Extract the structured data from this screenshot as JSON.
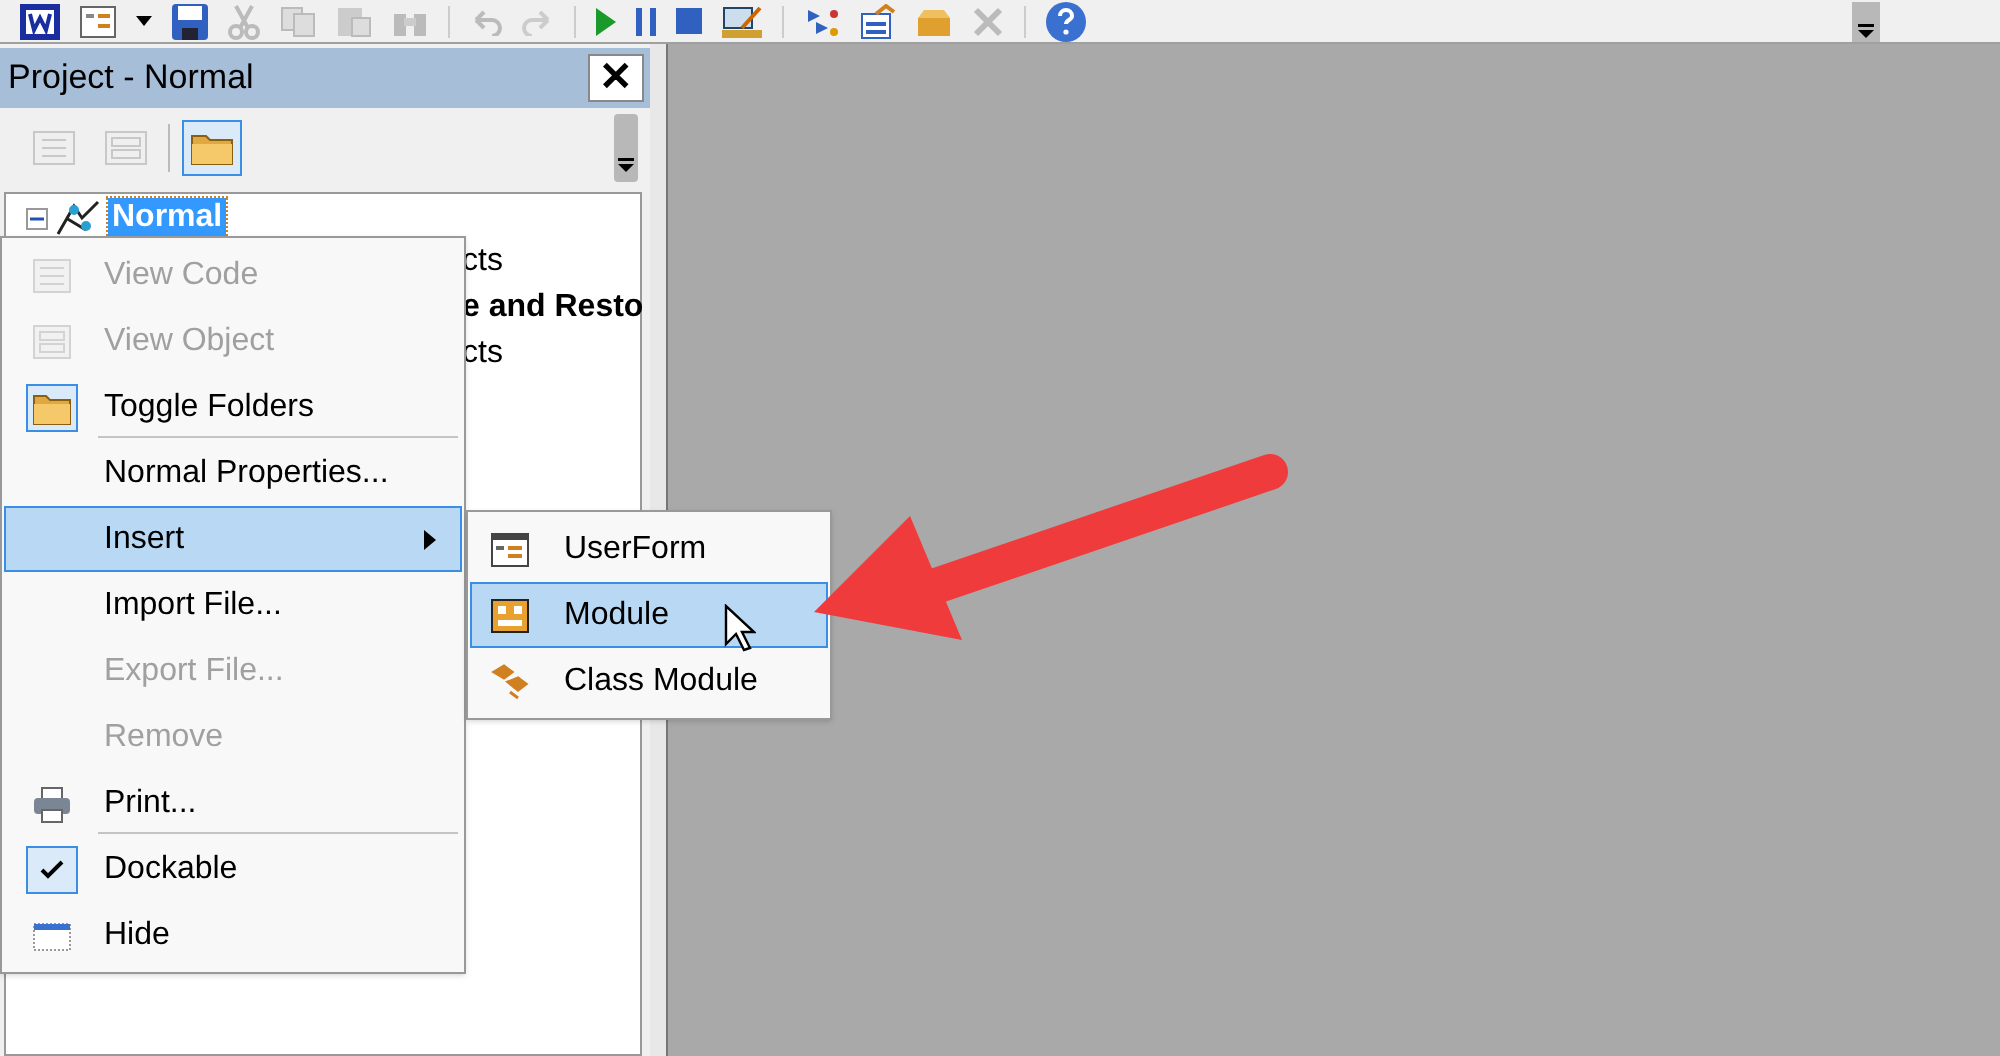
{
  "project_panel": {
    "title": "Project - Normal",
    "close_glyph": "✕",
    "toolbar": [
      {
        "disabled": true,
        "selected": false
      },
      {
        "disabled": true,
        "selected": false
      },
      {
        "disabled": false,
        "selected": true
      }
    ],
    "tree": [
      {
        "label": "Normal",
        "selected": true,
        "expanded": true,
        "children": [
          {
            "label": "cts",
            "selected": false
          },
          {
            "label": "e and Resto",
            "selected": false
          },
          {
            "label": "cts",
            "selected": false
          }
        ]
      }
    ]
  },
  "context_menu": [
    {
      "label": "View Code",
      "disabled": true,
      "checked": false,
      "selected": false,
      "submenu": false,
      "separator_after": false
    },
    {
      "label": "View Object",
      "disabled": true,
      "checked": false,
      "selected": false,
      "submenu": false,
      "separator_after": false
    },
    {
      "label": "Toggle Folders",
      "disabled": false,
      "checked": true,
      "selected": false,
      "submenu": false,
      "separator_after": true
    },
    {
      "label": "Normal Properties...",
      "disabled": false,
      "checked": false,
      "selected": false,
      "submenu": false,
      "separator_after": false
    },
    {
      "label": "Insert",
      "disabled": false,
      "checked": false,
      "selected": true,
      "submenu": true,
      "separator_after": false
    },
    {
      "label": "Import File...",
      "disabled": false,
      "checked": false,
      "selected": false,
      "submenu": false,
      "separator_after": false
    },
    {
      "label": "Export File...",
      "disabled": true,
      "checked": false,
      "selected": false,
      "submenu": false,
      "separator_after": false
    },
    {
      "label": "Remove",
      "disabled": true,
      "checked": false,
      "selected": false,
      "submenu": false,
      "separator_after": false
    },
    {
      "label": "Print...",
      "disabled": false,
      "checked": false,
      "selected": false,
      "submenu": false,
      "separator_after": true
    },
    {
      "label": "Dockable",
      "disabled": false,
      "checked": true,
      "selected": false,
      "submenu": false,
      "separator_after": false
    },
    {
      "label": "Hide",
      "disabled": false,
      "checked": false,
      "selected": false,
      "submenu": false,
      "separator_after": false
    }
  ],
  "insert_submenu": [
    {
      "label": "UserForm",
      "selected": false
    },
    {
      "label": "Module",
      "selected": true
    },
    {
      "label": "Class Module",
      "selected": false
    }
  ]
}
